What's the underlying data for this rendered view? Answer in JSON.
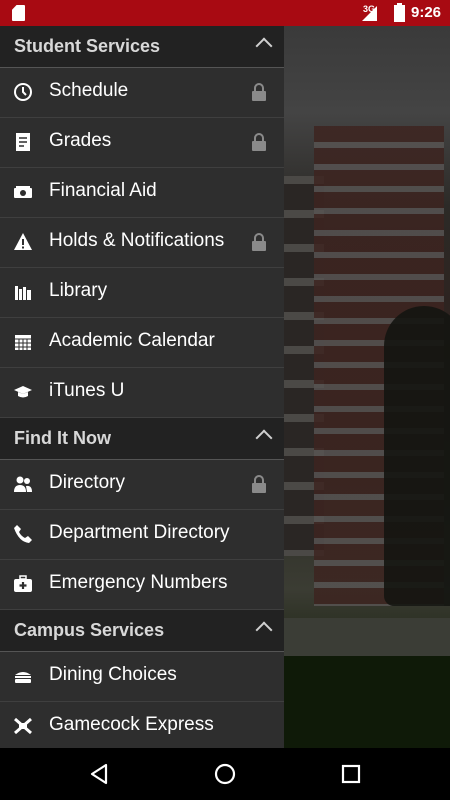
{
  "status_bar": {
    "network": "3G",
    "time": "9:26"
  },
  "sections": [
    {
      "title": "Student Services",
      "items": [
        {
          "label": "Schedule",
          "icon": "clock-icon",
          "locked": true
        },
        {
          "label": "Grades",
          "icon": "document-icon",
          "locked": true
        },
        {
          "label": "Financial Aid",
          "icon": "money-icon",
          "locked": false
        },
        {
          "label": "Holds & Notifications",
          "icon": "warning-icon",
          "locked": true
        },
        {
          "label": "Library",
          "icon": "books-icon",
          "locked": false
        },
        {
          "label": "Academic Calendar",
          "icon": "calendar-icon",
          "locked": false
        },
        {
          "label": "iTunes U",
          "icon": "graduation-cap-icon",
          "locked": false
        }
      ]
    },
    {
      "title": "Find It Now",
      "items": [
        {
          "label": "Directory",
          "icon": "people-icon",
          "locked": true
        },
        {
          "label": "Department Directory",
          "icon": "phone-icon",
          "locked": false
        },
        {
          "label": "Emergency Numbers",
          "icon": "first-aid-kit-icon",
          "locked": false
        }
      ]
    },
    {
      "title": "Campus Services",
      "items": [
        {
          "label": "Dining Choices",
          "icon": "food-icon",
          "locked": false
        },
        {
          "label": "Gamecock Express",
          "icon": "card-icon",
          "locked": false
        }
      ]
    }
  ],
  "colors": {
    "status_bar": "#a80a12",
    "drawer": "#2e2e2e",
    "header": "#222222"
  }
}
